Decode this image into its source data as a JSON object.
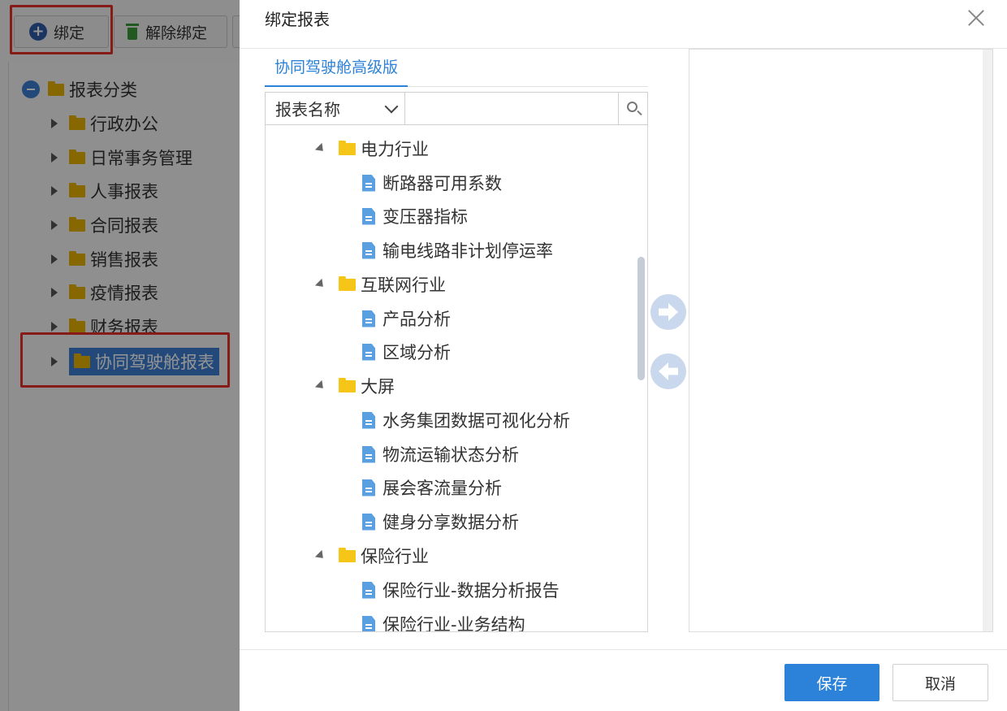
{
  "toolbar": {
    "bind_label": "绑定",
    "unbind_label": "解除绑定"
  },
  "category_tree": {
    "root_label": "报表分类",
    "items": [
      {
        "label": "行政办公"
      },
      {
        "label": "日常事务管理"
      },
      {
        "label": "人事报表"
      },
      {
        "label": "合同报表"
      },
      {
        "label": "销售报表"
      },
      {
        "label": "疫情报表"
      },
      {
        "label": "财务报表"
      },
      {
        "label": "协同驾驶舱报表"
      }
    ]
  },
  "dialog": {
    "title": "绑定报表",
    "tab_label": "协同驾驶舱高级版",
    "search": {
      "field_select": "报表名称",
      "placeholder": ""
    },
    "report_tree": [
      {
        "type": "folder",
        "label": "电力行业"
      },
      {
        "type": "report",
        "label": "断路器可用系数"
      },
      {
        "type": "report",
        "label": "变压器指标"
      },
      {
        "type": "report",
        "label": "输电线路非计划停运率"
      },
      {
        "type": "folder",
        "label": "互联网行业"
      },
      {
        "type": "report",
        "label": "产品分析"
      },
      {
        "type": "report",
        "label": "区域分析"
      },
      {
        "type": "folder",
        "label": "大屏"
      },
      {
        "type": "report",
        "label": "水务集团数据可视化分析"
      },
      {
        "type": "report",
        "label": "物流运输状态分析"
      },
      {
        "type": "report",
        "label": "展会客流量分析"
      },
      {
        "type": "report",
        "label": "健身分享数据分析"
      },
      {
        "type": "folder",
        "label": "保险行业"
      },
      {
        "type": "report",
        "label": "保险行业-数据分析报告"
      },
      {
        "type": "report",
        "label": "保险行业-业务结构"
      }
    ],
    "save_label": "保存",
    "cancel_label": "取消"
  },
  "colors": {
    "accent": "#2c82d8",
    "highlight_red": "#e8302a",
    "folder_yellow": "#f5c518"
  }
}
